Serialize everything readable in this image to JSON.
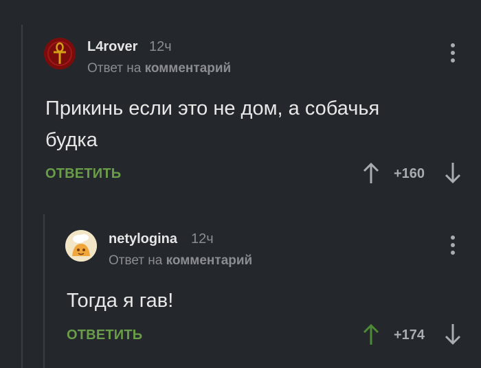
{
  "comments": [
    {
      "username": "L4rover",
      "time": "12ч",
      "reply_prefix": "Ответ на",
      "reply_target": "комментарий",
      "text": "Прикинь если это не дом, а собачья будка",
      "reply_label": "ОТВЕТИТЬ",
      "score": "+160",
      "avatar_icon": "ankh-icon",
      "colors": {
        "avatar_bg": "#8b0f0f",
        "avatar_symbol": "#d4a017"
      }
    },
    {
      "username": "netylogina",
      "time": "12ч",
      "reply_prefix": "Ответ на",
      "reply_target": "комментарий",
      "text": "Тогда я гав!",
      "reply_label": "ОТВЕТИТЬ",
      "score": "+174",
      "upvoted": true,
      "avatar_icon": "cartoon-avatar-icon",
      "colors": {
        "avatar_bg": "#f1e4c3",
        "upvote_active": "#4d8a35"
      }
    }
  ],
  "colors": {
    "background": "#24272b",
    "accent_green": "#6a9d4a",
    "muted": "#8a8d91"
  }
}
